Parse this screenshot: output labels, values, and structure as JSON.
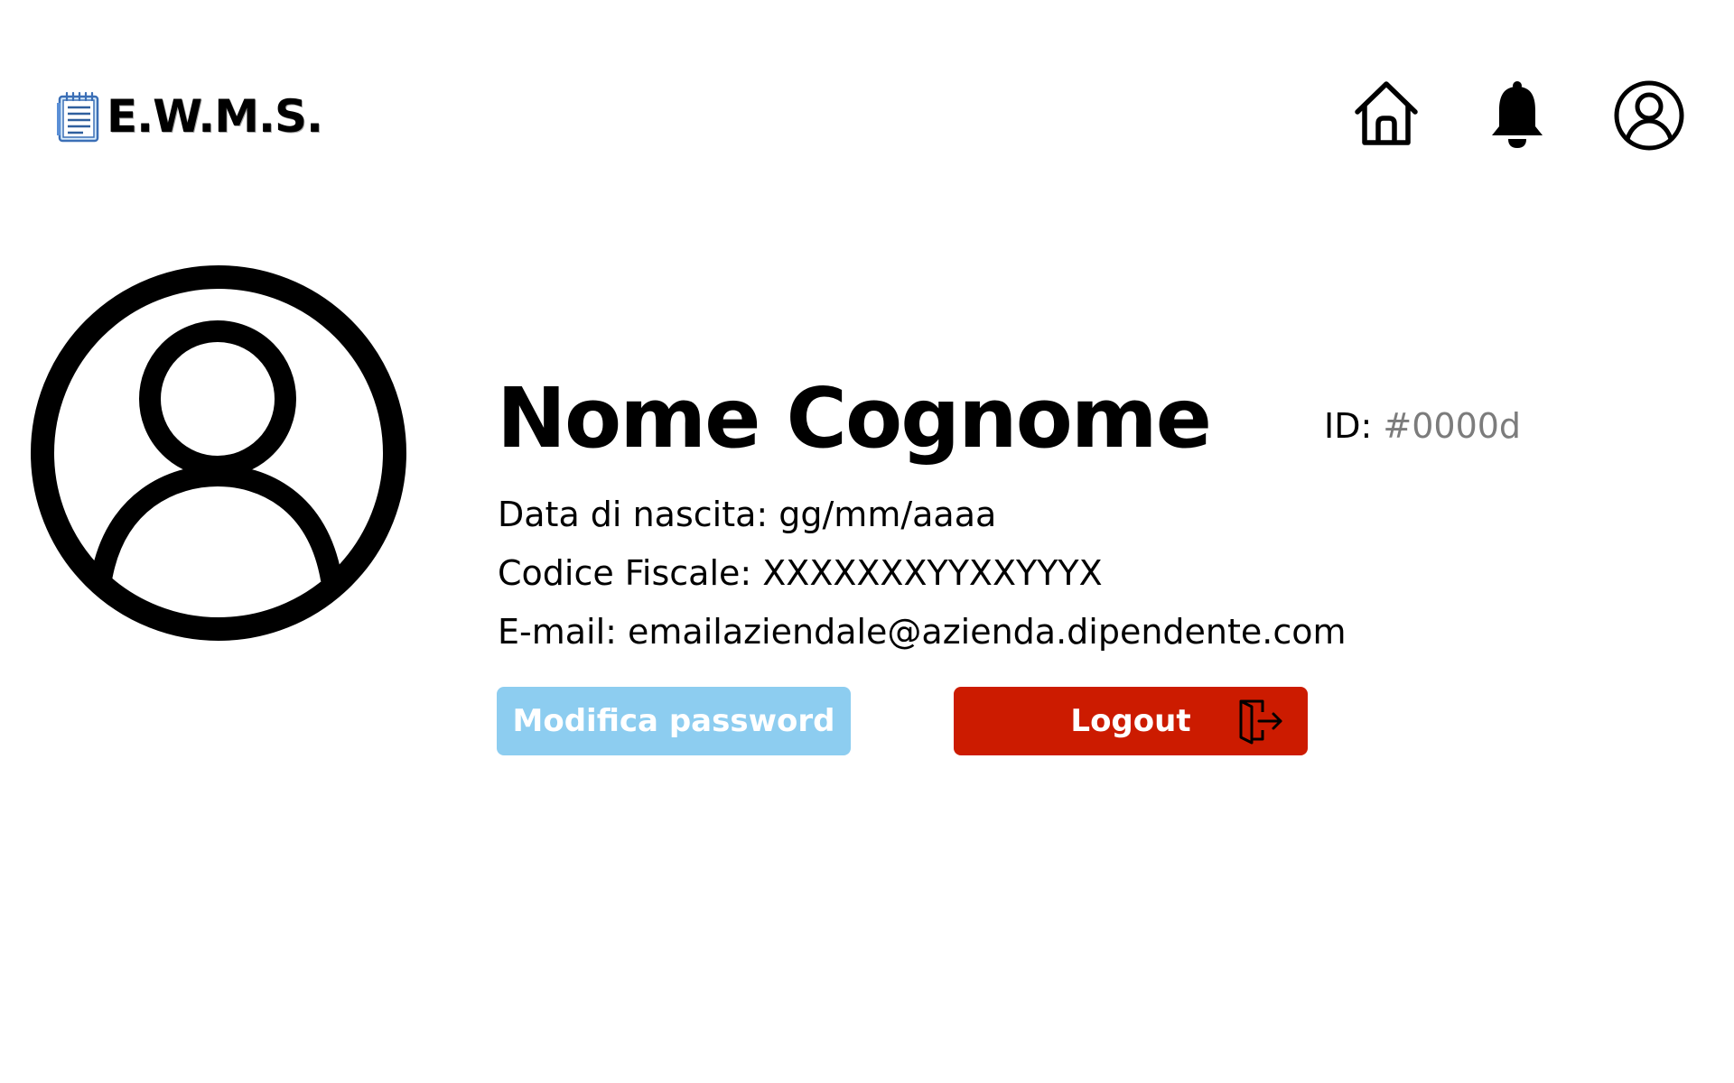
{
  "app": {
    "title": "E.W.M.S."
  },
  "header": {
    "icons": {
      "logo": "notepad-icon",
      "home": "home-icon",
      "notifications": "bell-icon",
      "account": "user-circle-icon"
    }
  },
  "profile": {
    "avatar_icon": "user-avatar-icon",
    "name": "Nome Cognome",
    "id_label": "ID:",
    "id_value": "#0000d",
    "birth_date": "Data di nascita: gg/mm/aaaa",
    "fiscal_code": "Codice Fiscale: XXXXXXXYYXXYYYX",
    "email": "E-mail: emailaziendale@azienda.dipendente.com"
  },
  "actions": {
    "change_password_label": "Modifica password",
    "logout_label": "Logout",
    "logout_icon": "logout-door-icon"
  },
  "colors": {
    "password_button": "#8dcdf0",
    "logout_button": "#cc1b00",
    "id_value": "#7c7c7c"
  }
}
